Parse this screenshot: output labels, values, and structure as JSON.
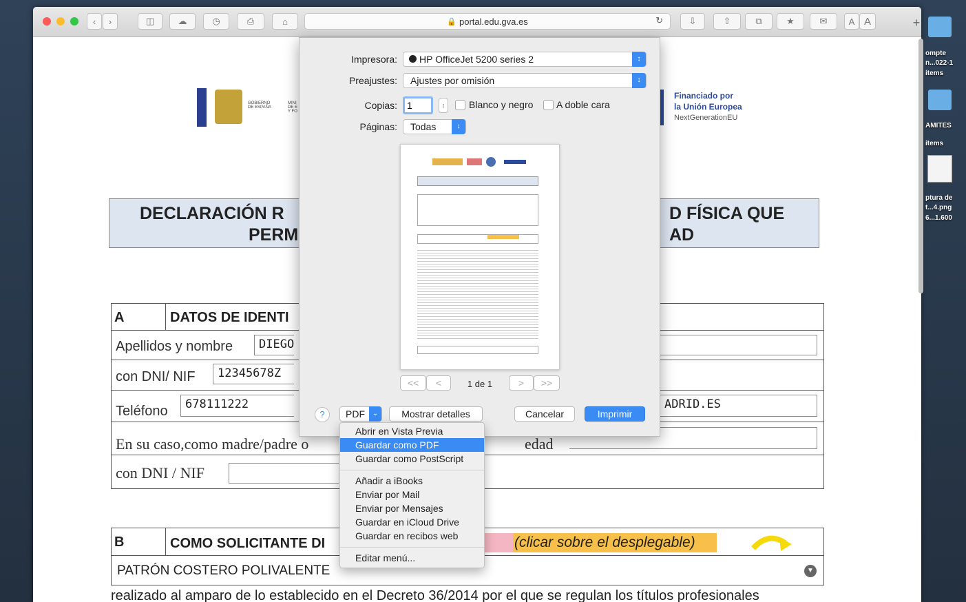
{
  "desktop": {
    "items": [
      "ompte",
      "n...022-1",
      "ítems",
      "AMITES",
      "ítems",
      "ptura de",
      "t...4.png",
      "6...1.600"
    ]
  },
  "browser": {
    "url": "portal.edu.gva.es",
    "reader_small": "A",
    "reader_large": "A",
    "new_tab": "+"
  },
  "document": {
    "logos": {
      "gobierno": "GOBIERNO DE ESPAÑA",
      "ministerio": "MINI DE E Y FO",
      "eu_line1": "Financiado por",
      "eu_line2": "la Unión Europea",
      "eu_line3": "NextGenerationEU"
    },
    "title_left_1": "DECLARACIÓN R",
    "title_left_2": "PERM",
    "title_right_1": "D FÍSICA QUE",
    "title_right_2": "AD",
    "section_a": {
      "letter": "A",
      "heading": "DATOS DE IDENTI",
      "name_label": "Apellidos y nombre",
      "name_value": "DIEGO",
      "dni_label": "con DNI/ NIF",
      "dni_value": "12345678Z",
      "phone_label": "Teléfono",
      "phone_value": "678111222",
      "email_value_tail": "ADRID.ES",
      "guardian_label": "En su caso,como madre/padre o",
      "guardian_tail": "edad",
      "guardian_dni_label": "con DNI / NIF"
    },
    "section_b": {
      "letter": "B",
      "heading": "COMO SOLICITANTE DI",
      "hint": "(clicar sobre el desplegable)",
      "course_value": "PATRÓN COSTERO POLIVALENTE"
    },
    "body_text": "realizado al amparo de lo establecido en el Decreto 36/2014 por el que se regulan los títulos profesionales"
  },
  "print_dialog": {
    "printer_label": "Impresora:",
    "printer_value": "HP OfficeJet 5200 series 2",
    "presets_label": "Preajustes:",
    "presets_value": "Ajustes por omisión",
    "copies_label": "Copias:",
    "copies_value": "1",
    "bw_label": "Blanco y negro",
    "duplex_label": "A doble cara",
    "pages_label": "Páginas:",
    "pages_value": "Todas",
    "page_counter": "1 de 1",
    "help": "?",
    "pdf_button": "PDF",
    "details_button": "Mostrar detalles",
    "cancel_button": "Cancelar",
    "print_button": "Imprimir",
    "nav_first": "<<",
    "nav_prev": "<",
    "nav_next": ">",
    "nav_last": ">>"
  },
  "pdf_menu": {
    "items": [
      "Abrir en Vista Previa",
      "Guardar como PDF",
      "Guardar como PostScript",
      "Añadir a iBooks",
      "Enviar por Mail",
      "Enviar por Mensajes",
      "Guardar en iCloud Drive",
      "Guardar en recibos web",
      "Editar menú..."
    ],
    "selected": "Guardar como PDF"
  },
  "colors": {
    "accent": "#3b8bf5",
    "title_box": "#dde5f1",
    "hint_highlight": "#f7c04a",
    "pink": "#f4b6c2"
  }
}
